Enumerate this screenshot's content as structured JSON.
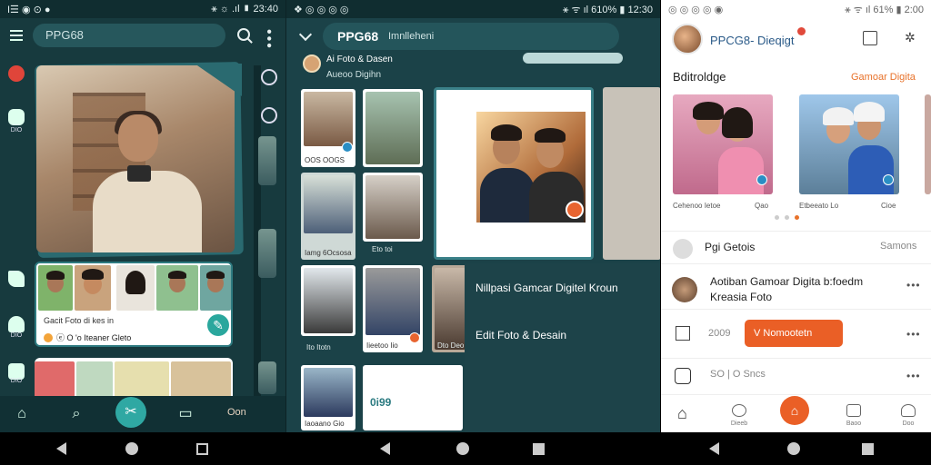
{
  "panel1": {
    "status": {
      "left_icons": "I☰ ◉ ⊙ ●",
      "right": "⚹ ☼ .ıl ▮ 23:40"
    },
    "search_text": "PPG68",
    "rail_labels": [
      "",
      "DIO",
      "",
      "DIO",
      "DIO"
    ],
    "card1_caption": "Gacit Foto di kes in",
    "card1_sub": "ⓔ O   'o   Iteaner Gleto",
    "nav_label": "Oon"
  },
  "panel2": {
    "status": {
      "left": "❖ ◎ ◎ ◎ ◎",
      "right": "⚹ ᯤ ıl 610% ▮ 12:30"
    },
    "title": "PPG68",
    "title_sub": "Imnlleheni",
    "sub1": "Ai Foto & Dasen",
    "sub2": "Aueoo Digihn",
    "grid_captions": [
      "OOS OOGS",
      "",
      "Iamg 6Ocsosa",
      "Eto toi",
      "Dto Deo",
      "Iieetoo Iio",
      "Ito Itotn",
      "Iaoaano Gio",
      ""
    ],
    "chart_number": "0i99",
    "overlay_1": "Nillpasi Gamcar Digitel Kroun",
    "overlay_2": "Edit Foto & Desain"
  },
  "panel3": {
    "status": {
      "left": "◎ ◎ ◎ ◎ ◉",
      "right": "⚹ ᯤ ıl 61% ▮ 2:00"
    },
    "title": "PPCG8- Dieqigt",
    "section_left": "Bditroldge",
    "section_right": "Gamoar Digita",
    "card_captions": [
      "Cehenoo Ietoe",
      "Qao",
      "Etbeeato Lo",
      "Cioe"
    ],
    "row1": {
      "text": "Pgi Getois",
      "right": "Samons"
    },
    "row2": {
      "line1": "Aotiban Gamoar Digita b:foedm",
      "line2": "Kreasia Foto"
    },
    "row3": {
      "left": "2009",
      "button": "V Nomootetn"
    },
    "row4": {
      "text": "SO  | O Sncs"
    },
    "nav_labels": [
      "",
      "Dieeb",
      "",
      "Baoo",
      "Doo"
    ]
  },
  "colors": {
    "teal_dark": "#173a3e",
    "accent_teal": "#2fa8a3",
    "orange": "#ea5f26"
  }
}
